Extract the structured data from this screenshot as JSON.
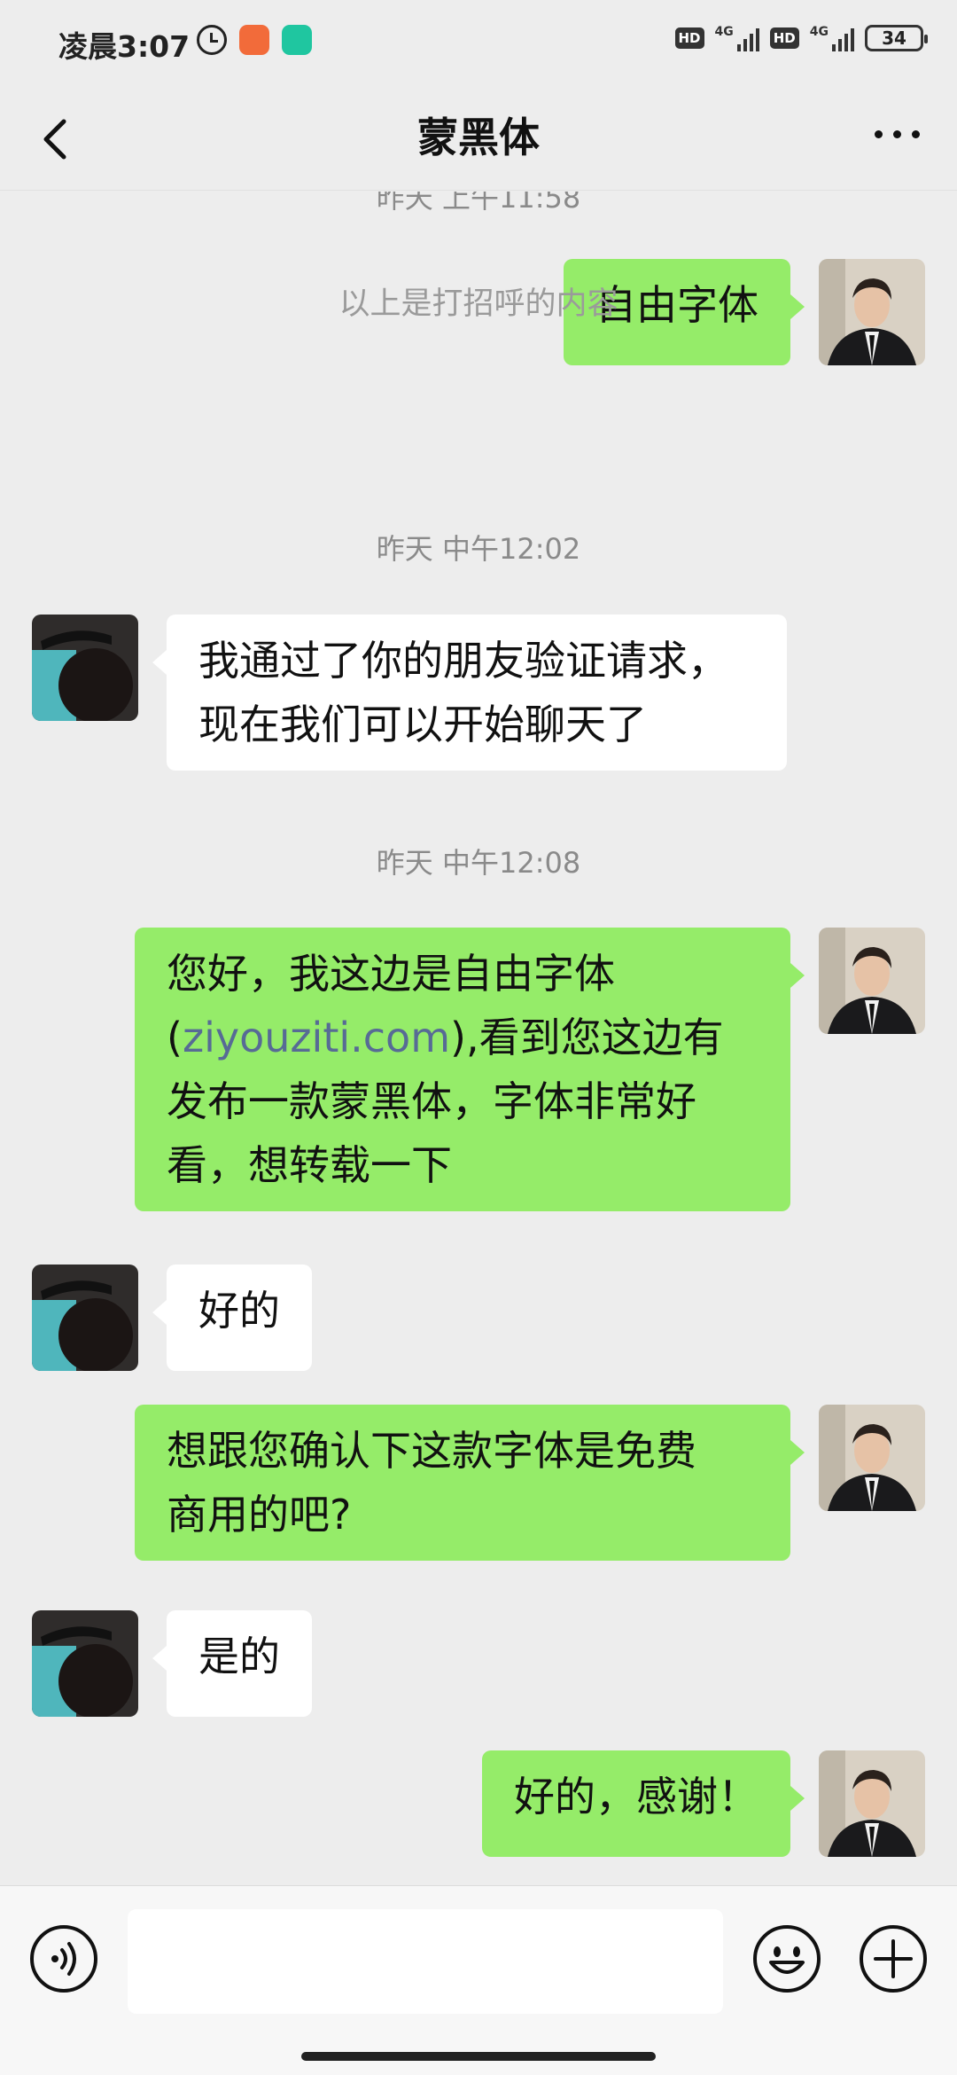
{
  "status_bar": {
    "time": "凌晨3:07",
    "hd1": "HD",
    "net1": "4G",
    "hd2": "HD",
    "net2": "4G",
    "battery": "34"
  },
  "header": {
    "title": "蒙黑体",
    "back_icon": "chevron-left-icon",
    "more_icon": "more-dots-icon"
  },
  "messages": {
    "partial_timestamp": "昨天 上午11:58",
    "msg1": "自由字体",
    "system_notice": "以上是打招呼的内容",
    "timestamp1": "昨天 中午12:02",
    "msg2_line1": "我通过了你的朋友验证请求，",
    "msg2_line2": "现在我们可以开始聊天了",
    "timestamp2": "昨天 中午12:08",
    "msg3_line1": "您好，我这边是自由字体",
    "msg3_paren_open": "(",
    "msg3_link": "ziyouziti.com",
    "msg3_after_link": "),看到您这边有",
    "msg3_line3": "发布一款蒙黑体，字体非常好",
    "msg3_line4": "看，想转载一下",
    "msg4": "好的",
    "msg5_line1": "想跟您确认下这款字体是免费",
    "msg5_line2": "商用的吧?",
    "msg6": "是的",
    "msg7": "好的，感谢！"
  },
  "input_bar": {
    "voice_icon": "voice-icon",
    "emoji_icon": "emoji-icon",
    "plus_icon": "plus-icon",
    "text_value": ""
  },
  "colors": {
    "my_bubble": "#95ec69",
    "their_bubble": "#ffffff",
    "background": "#ededed",
    "link": "#576b95"
  }
}
